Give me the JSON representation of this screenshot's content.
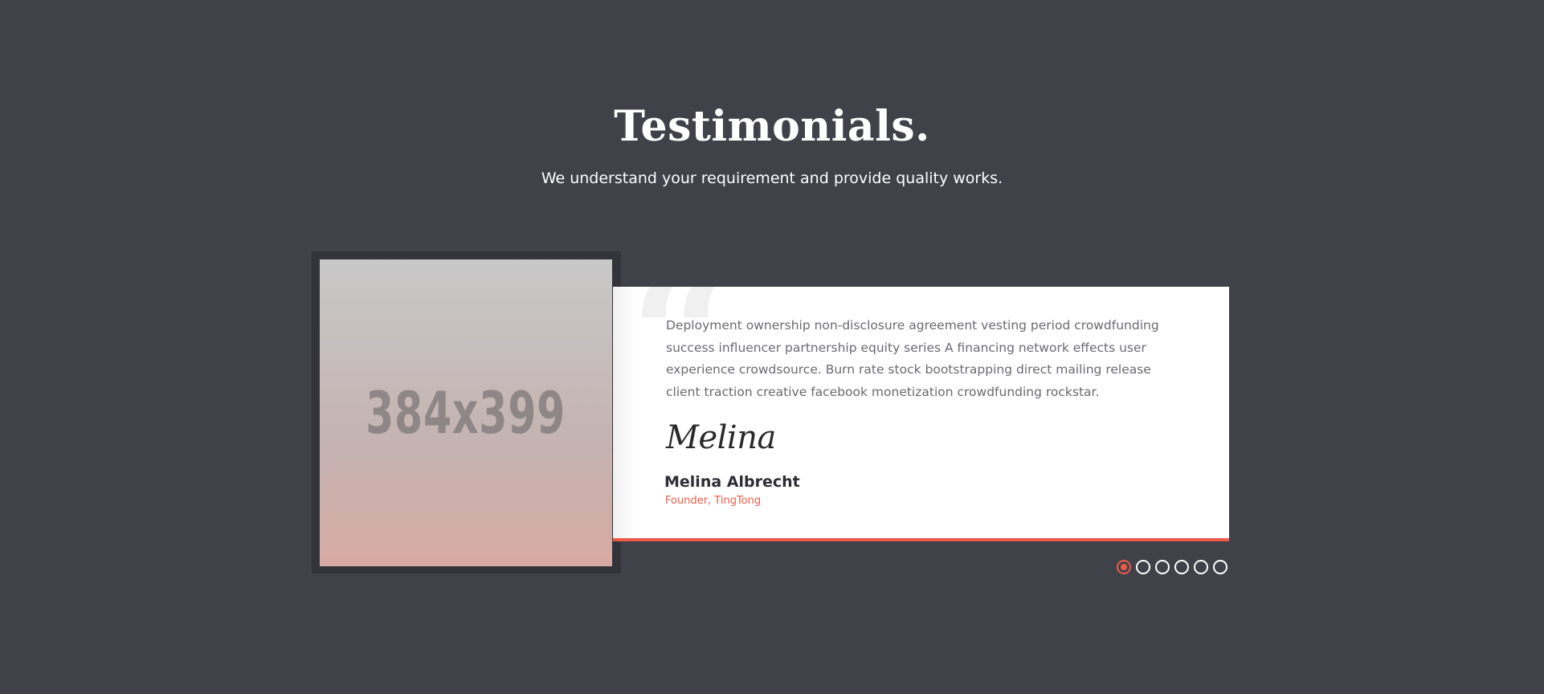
{
  "section": {
    "title": "Testimonials.",
    "subtitle": "We understand your requirement and provide quality works."
  },
  "testimonial": {
    "image_placeholder": "384x399",
    "quote_glyph": "“",
    "quote": "Deployment ownership non-disclosure agreement vesting period crowdfunding success influencer partnership equity series A financing network effects user experience crowdsource. Burn rate stock bootstrapping direct mailing release client traction creative facebook monetization crowdfunding rockstar.",
    "signature": "Melina",
    "author_name": "Melina Albrecht",
    "author_role": "Founder, TingTong"
  },
  "slider": {
    "total_slides": 6,
    "active_slide": 1
  },
  "colors": {
    "background": "#41414a",
    "accent": "#ec5b47",
    "card": "#ffffff",
    "frame": "#33333b"
  }
}
